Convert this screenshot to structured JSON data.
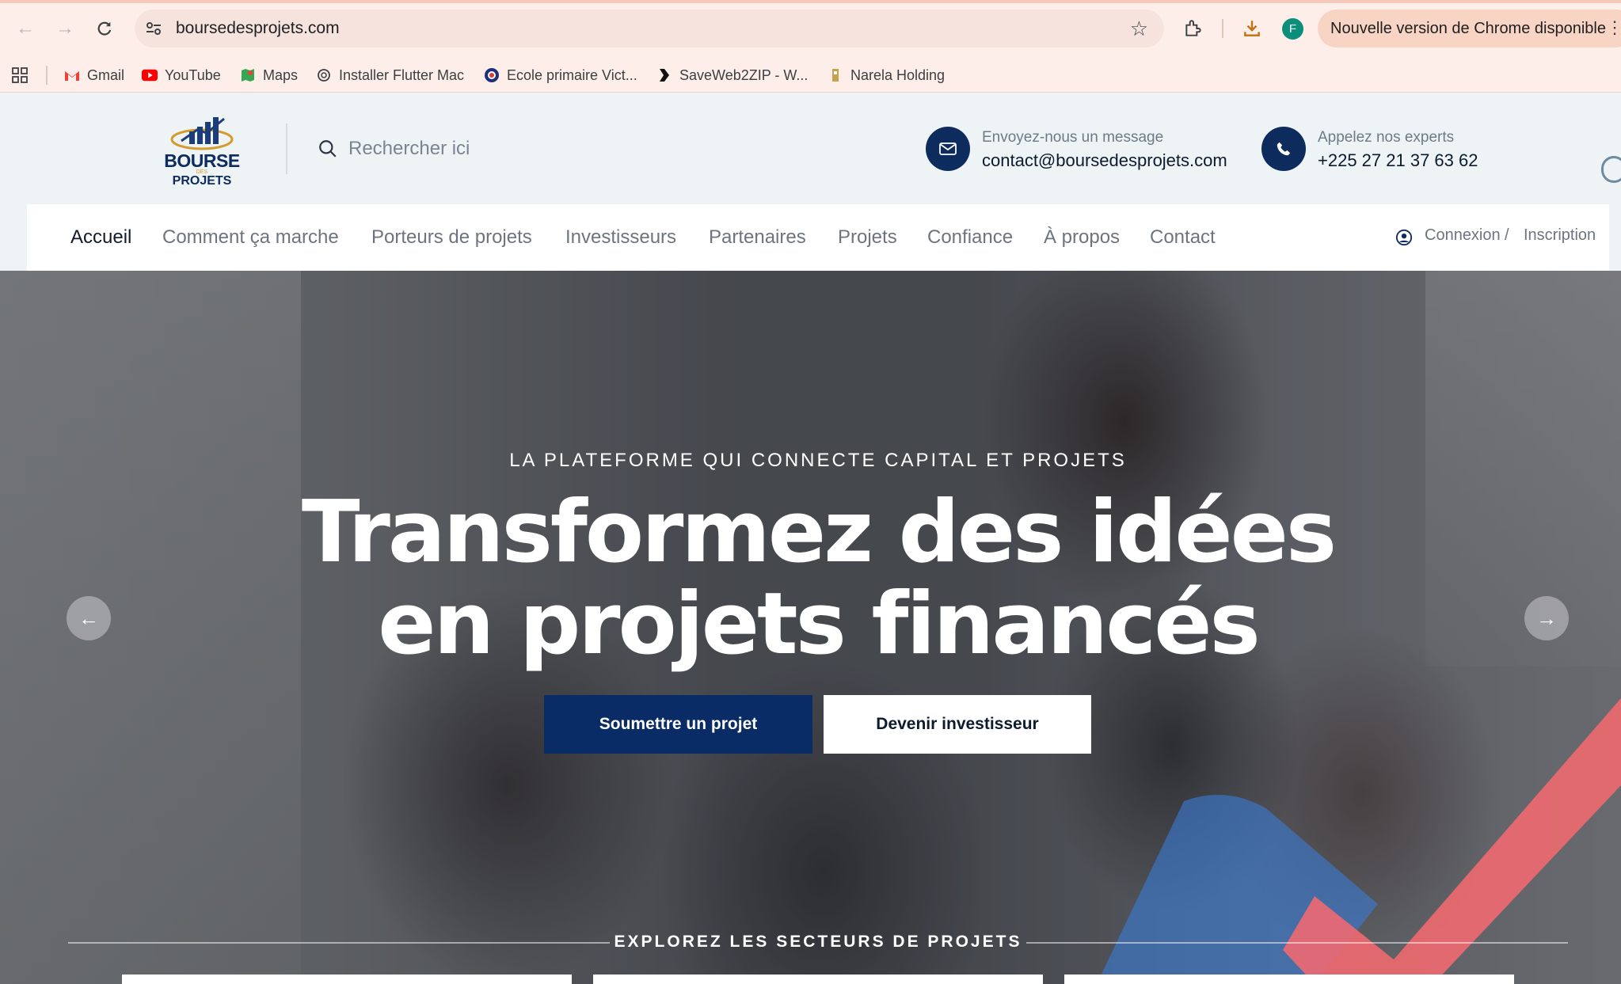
{
  "browser": {
    "url": "boursedesprojets.com",
    "profile_initial": "F",
    "update_label": "Nouvelle version de Chrome disponible",
    "bookmarks": [
      {
        "label": "Gmail",
        "icon": "gmail-icon"
      },
      {
        "label": "YouTube",
        "icon": "youtube-icon"
      },
      {
        "label": "Maps",
        "icon": "maps-icon"
      },
      {
        "label": "Installer Flutter Mac",
        "icon": "openai-icon"
      },
      {
        "label": "Ecole primaire Vict...",
        "icon": "school-icon"
      },
      {
        "label": "SaveWeb2ZIP - W...",
        "icon": "saveweb-icon"
      },
      {
        "label": "Narela Holding",
        "icon": "narela-icon"
      }
    ]
  },
  "header": {
    "logo": {
      "line1": "BOURSE",
      "line2": "DES",
      "line3": "PROJETS"
    },
    "search_placeholder": "Rechercher ici",
    "email": {
      "label": "Envoyez-nous un message",
      "value": "contact@boursedesprojets.com"
    },
    "phone": {
      "label": "Appelez nos experts",
      "value": "+225 27 21 37 63 62"
    }
  },
  "nav": {
    "items": [
      "Accueil",
      "Comment ça marche",
      "Porteurs de projets",
      "Investisseurs",
      "Partenaires",
      "Projets",
      "Confiance",
      "À propos",
      "Contact"
    ],
    "active": "Accueil",
    "login": "Connexion",
    "divider": "/",
    "signup": "Inscription"
  },
  "hero": {
    "eyebrow": "LA PLATEFORME QUI CONNECTE CAPITAL ET PROJETS",
    "title_line1": "Transformez des idées",
    "title_line2": "en projets financés",
    "cta_primary": "Soumettre un projet",
    "cta_secondary": "Devenir investisseur",
    "prev_arrow": "←",
    "next_arrow": "→",
    "sectors_title": "EXPLOREZ LES SECTEURS DE PROJETS"
  },
  "colors": {
    "brand_navy": "#0a2c66",
    "accent_coral": "#f26a70",
    "accent_blue": "#3a7bd5",
    "chrome_bg": "#fdeee9"
  }
}
